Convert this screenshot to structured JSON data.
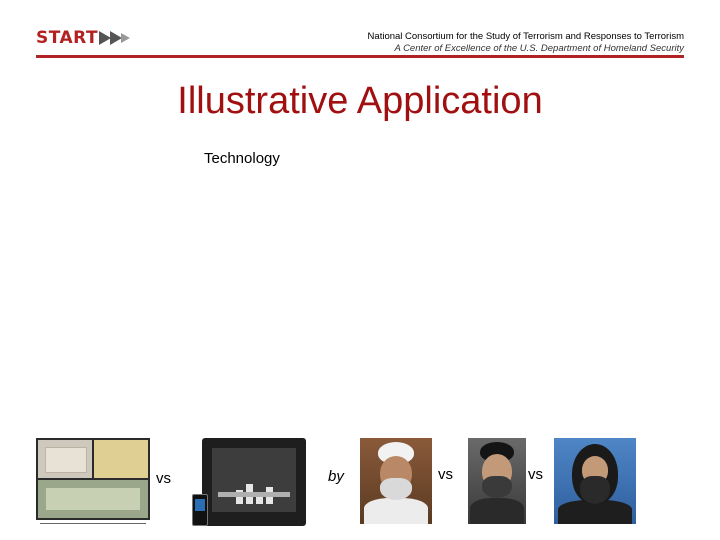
{
  "header": {
    "logo_text": "START",
    "org_name": "National Consortium for the Study of Terrorism and Responses to Terrorism",
    "org_subtitle": "A Center of Excellence of the U.S. Department of Homeland Security"
  },
  "slide": {
    "title": "Illustrative Application",
    "subheading": "Technology"
  },
  "connectors": {
    "vs_1": "vs",
    "by": "by",
    "vs_2": "vs",
    "vs_3": "vs"
  },
  "colors": {
    "brand_red": "#b22222",
    "title_red": "#a01010"
  }
}
